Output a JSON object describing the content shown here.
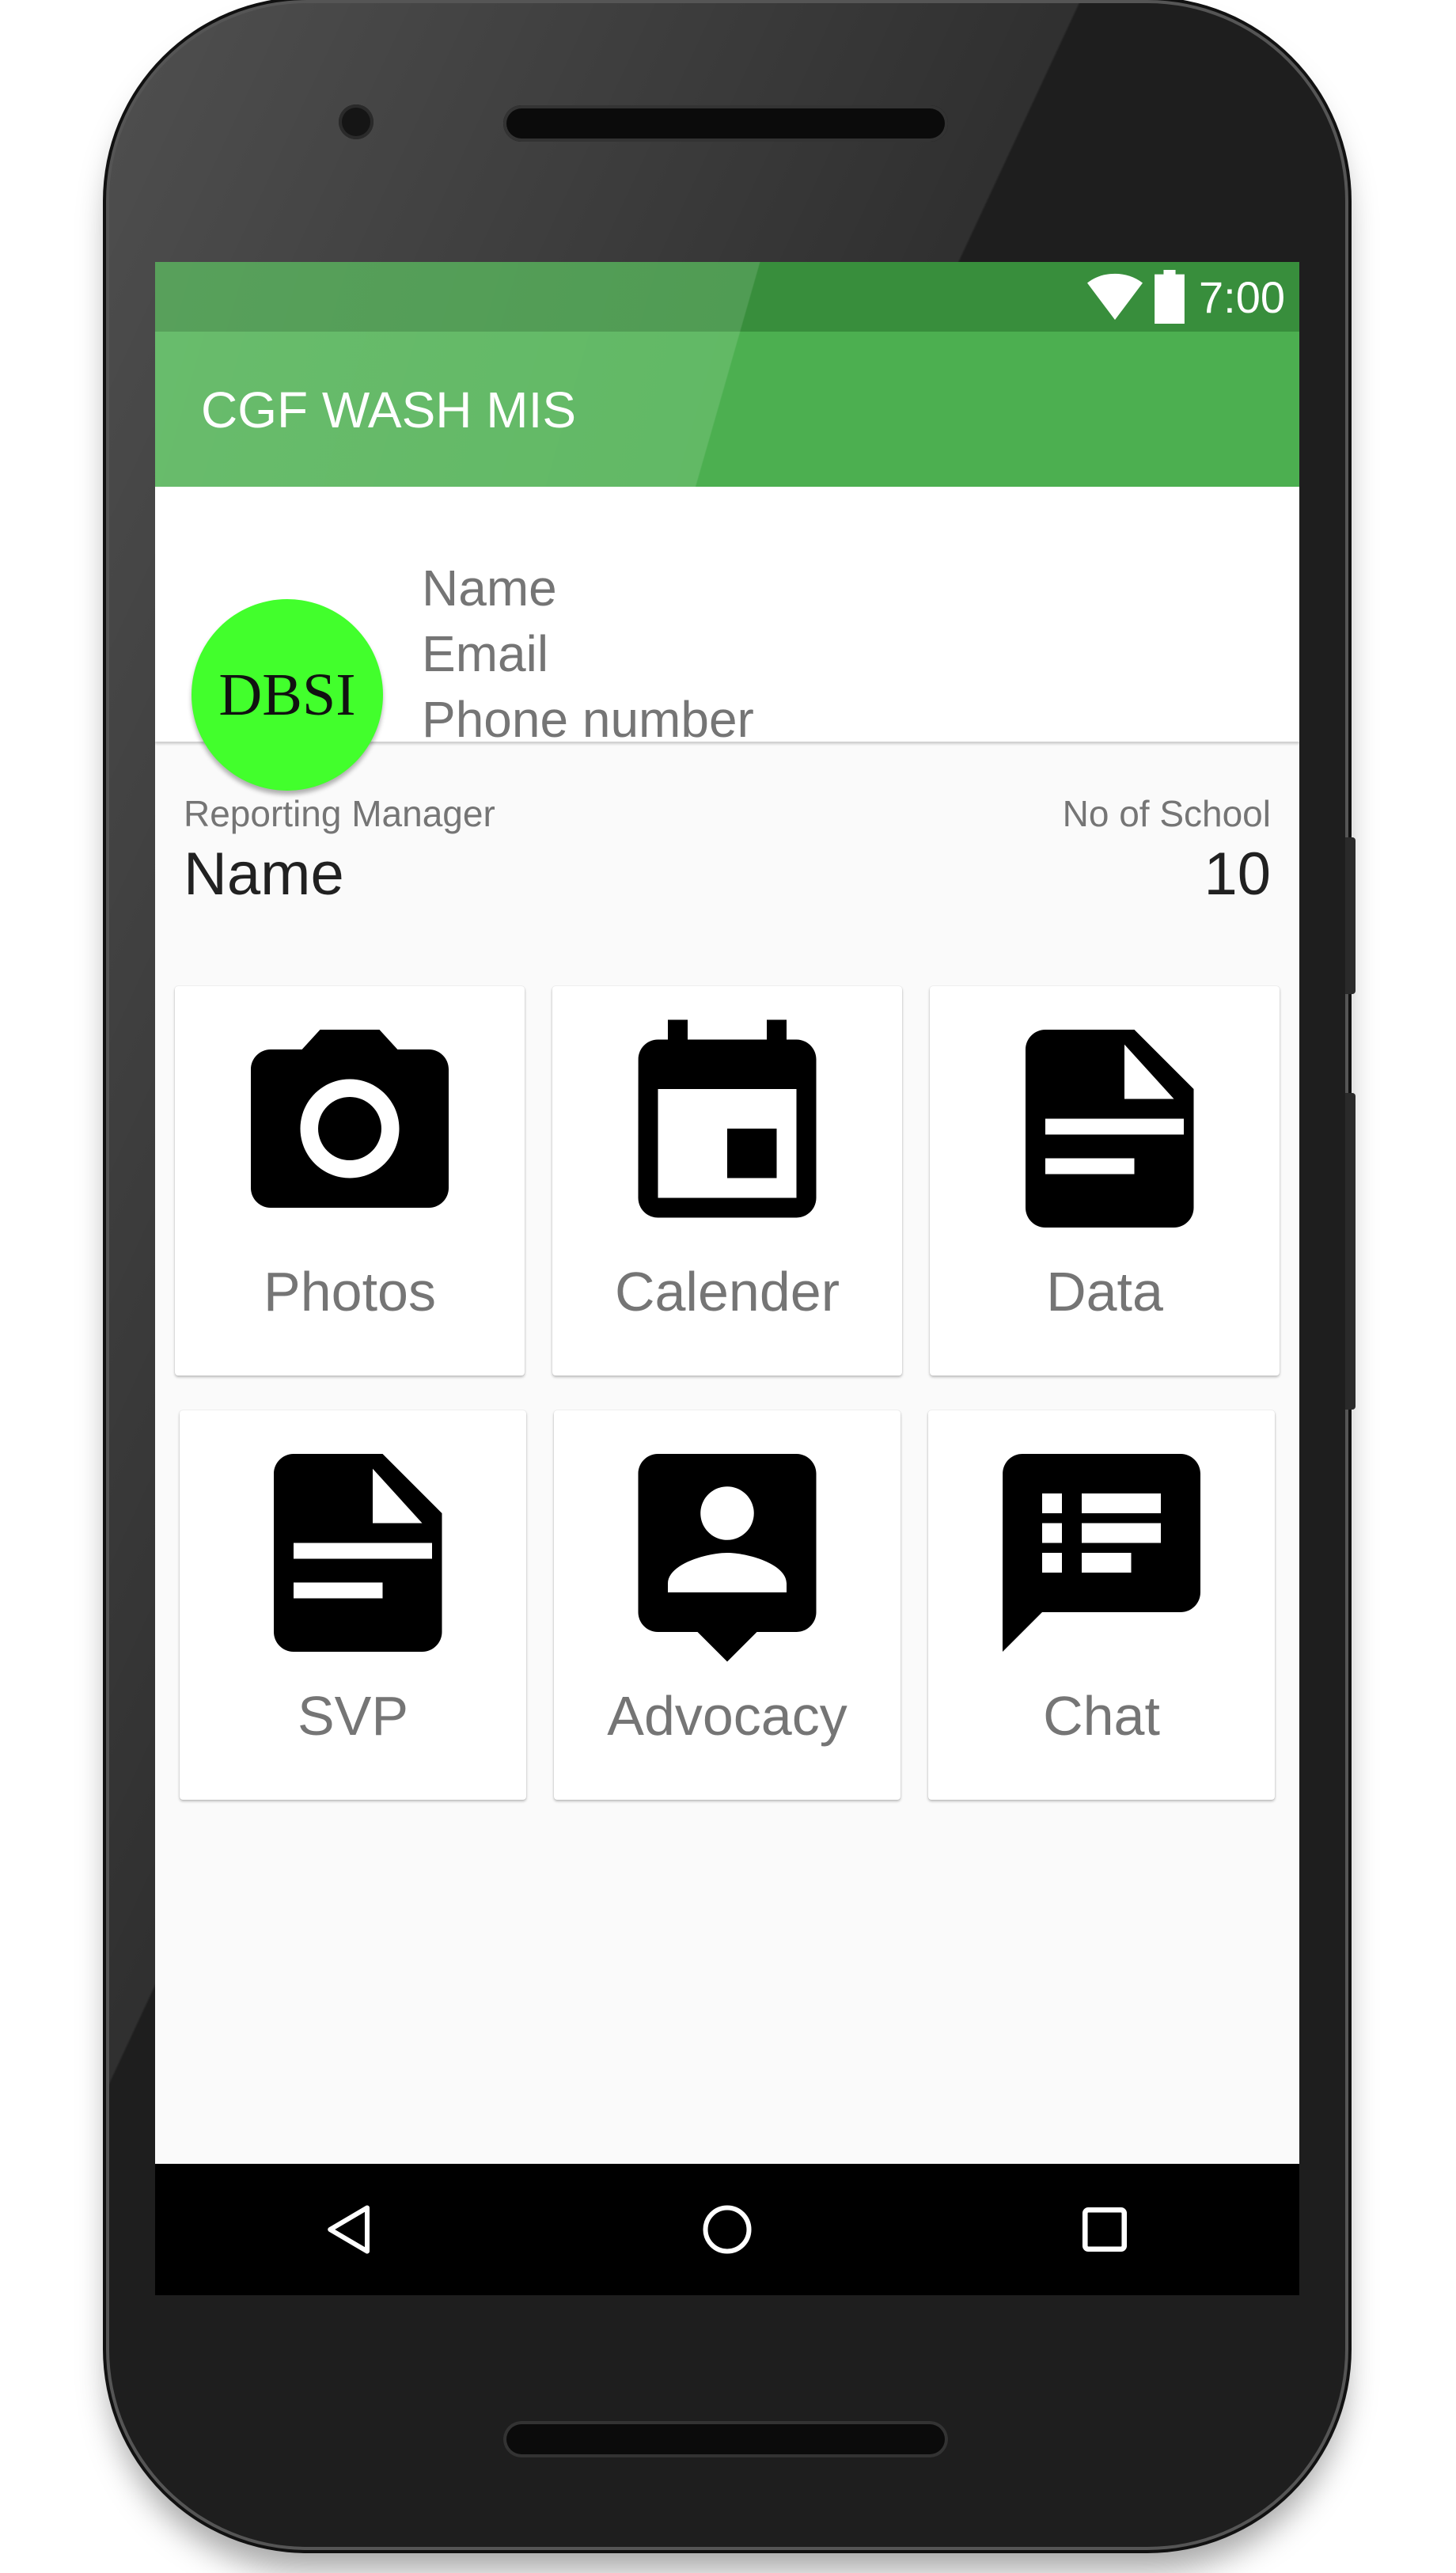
{
  "status_bar": {
    "time": "7:00",
    "icons": [
      "wifi-icon",
      "battery-icon"
    ],
    "color": "#388e3c"
  },
  "app_bar": {
    "title": "CGF WASH MIS",
    "color": "#4caf50"
  },
  "profile": {
    "avatar_text": "DBSI",
    "avatar_color": "#42ff2c",
    "name": "Name",
    "email": "Email",
    "phone": "Phone number",
    "reporting_manager_label": "Reporting Manager",
    "reporting_manager_value": "Name",
    "schools_label": "No of School",
    "schools_value": "10"
  },
  "tiles": [
    {
      "label": "Photos",
      "icon": "camera-icon"
    },
    {
      "label": "Calender",
      "icon": "calendar-icon"
    },
    {
      "label": "Data",
      "icon": "document-icon"
    },
    {
      "label": "SVP",
      "icon": "document-icon"
    },
    {
      "label": "Advocacy",
      "icon": "person-pin-icon"
    },
    {
      "label": "Chat",
      "icon": "chat-notes-icon"
    }
  ],
  "nav_bar": {
    "buttons": [
      "back",
      "home",
      "recents"
    ]
  }
}
